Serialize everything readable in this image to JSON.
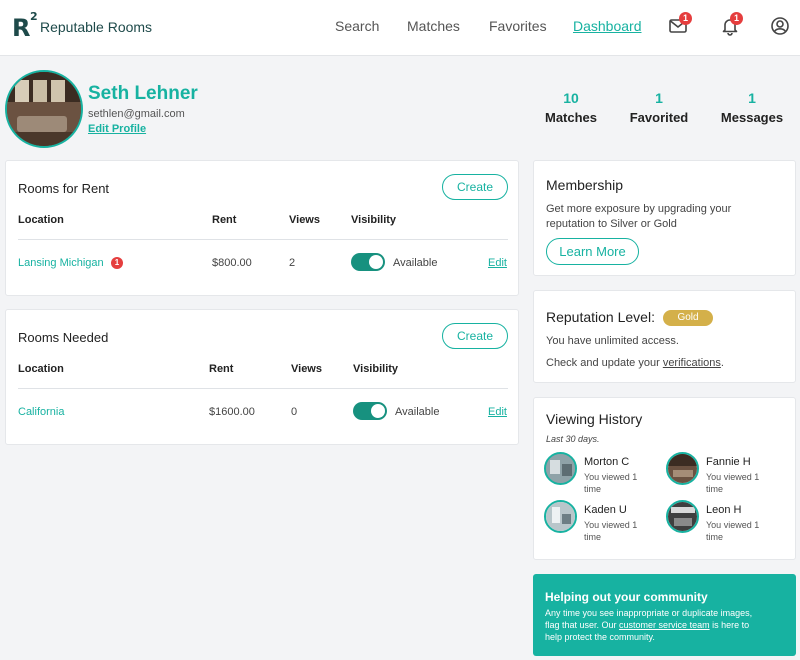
{
  "header": {
    "logo_mark": "R",
    "logo_sup": "2",
    "brand": "Reputable Rooms",
    "nav": [
      "Search",
      "Matches",
      "Favorites",
      "Dashboard"
    ],
    "mail_badge": "1",
    "bell_badge": "1"
  },
  "profile": {
    "name": "Seth Lehner",
    "email": "sethlen@gmail.com",
    "edit_label": "Edit Profile"
  },
  "stats": [
    {
      "num": "10",
      "label": "Matches"
    },
    {
      "num": "1",
      "label": "Favorited"
    },
    {
      "num": "1",
      "label": "Messages"
    }
  ],
  "rooms_for_rent": {
    "title": "Rooms for Rent",
    "create": "Create",
    "headers": [
      "Location",
      "Rent",
      "Views",
      "Visibility"
    ],
    "row": {
      "location": "Lansing Michigan",
      "badge": "1",
      "rent": "$800.00",
      "views": "2",
      "visibility": "Available",
      "edit": "Edit"
    }
  },
  "rooms_needed": {
    "title": "Rooms Needed",
    "create": "Create",
    "headers": [
      "Location",
      "Rent",
      "Views",
      "Visibility"
    ],
    "row": {
      "location": "California",
      "rent": "$1600.00",
      "views": "0",
      "visibility": "Available",
      "edit": "Edit"
    }
  },
  "membership": {
    "title": "Membership",
    "line1": "Get more exposure by upgrading your",
    "line2": "reputation to Silver or Gold",
    "button": "Learn More"
  },
  "reputation": {
    "title": "Reputation Level:",
    "level": "Gold",
    "line1": "You have unlimited access.",
    "line2_pre": "Check and update your ",
    "line2_link": "verifications",
    "line2_post": "."
  },
  "viewing_history": {
    "title": "Viewing History",
    "subtitle": "Last 30 days.",
    "people": [
      {
        "name": "Morton C",
        "line1": "You viewed 1",
        "line2": "time"
      },
      {
        "name": "Fannie H",
        "line1": "You viewed 1",
        "line2": "time"
      },
      {
        "name": "Kaden U",
        "line1": "You viewed 1",
        "line2": "time"
      },
      {
        "name": "Leon H",
        "line1": "You viewed 1",
        "line2": "time"
      }
    ]
  },
  "community": {
    "title": "Helping out your community",
    "line1": "Any time you see inappropriate or duplicate images,",
    "line2_pre": "flag that user. Our ",
    "line2_link": "customer service team",
    "line2_post": " is here to",
    "line3": "help protect the community."
  },
  "colors": {
    "accent": "#17b2a1",
    "badge": "#e53e3e",
    "gold": "#d4b04a"
  }
}
